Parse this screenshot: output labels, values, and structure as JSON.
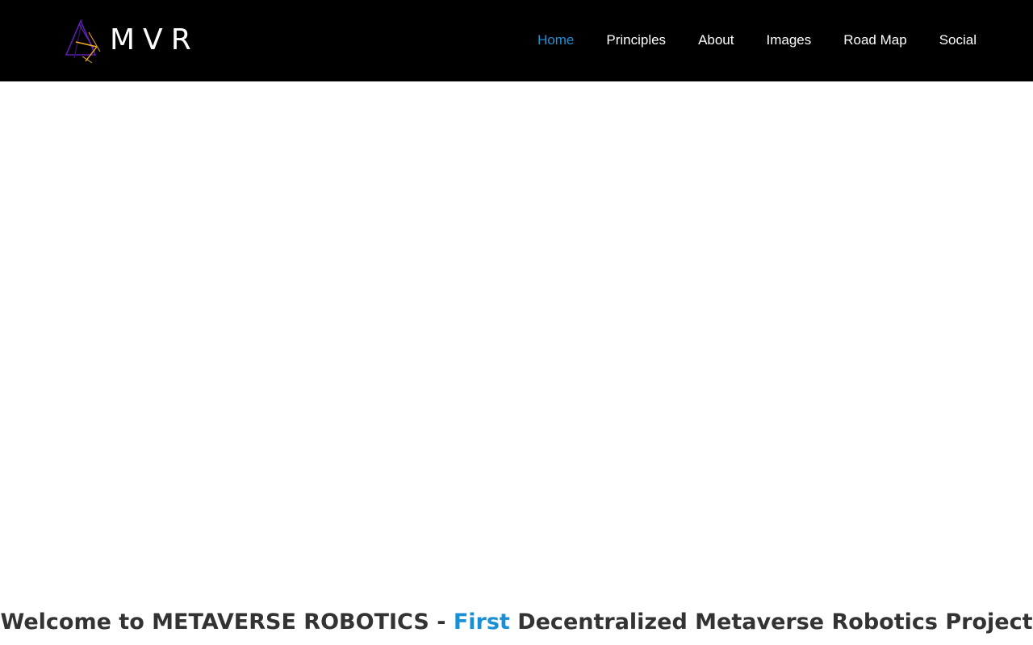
{
  "brand": {
    "name": "MVR",
    "logo_icon": "triangle-logo-icon",
    "logo_colors": [
      "#5a1fa8",
      "#f2b01e"
    ]
  },
  "nav": {
    "items": [
      {
        "label": "Home",
        "active": true
      },
      {
        "label": "Principles",
        "active": false
      },
      {
        "label": "About",
        "active": false
      },
      {
        "label": "Images",
        "active": false
      },
      {
        "label": "Road Map",
        "active": false
      },
      {
        "label": "Social",
        "active": false
      }
    ]
  },
  "hero": {
    "welcome_prefix": "Welcome to ",
    "welcome_brand": "METAVERSE ROBOTICS",
    "welcome_sep": " - ",
    "welcome_accent": "First",
    "welcome_suffix": " Decentralized Metaverse Robotics Project"
  },
  "colors": {
    "header_bg": "#000000",
    "accent": "#1a8fd6",
    "text": "#333333"
  }
}
